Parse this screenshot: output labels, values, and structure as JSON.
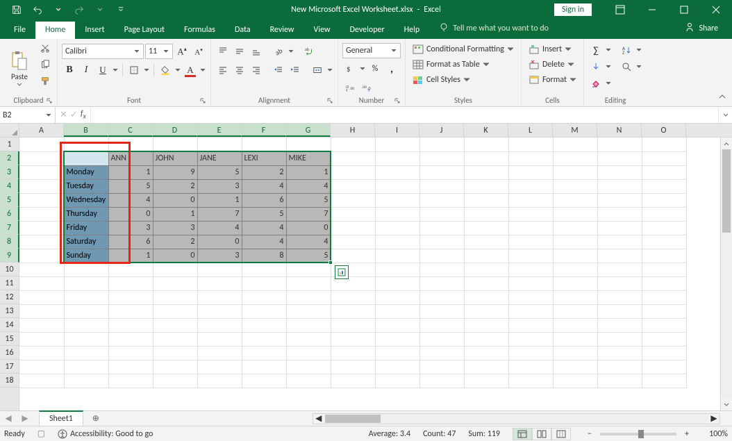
{
  "titlebar": {
    "filename": "New Microsoft Excel Worksheet.xlsx",
    "app": "Excel",
    "signin": "Sign in"
  },
  "tabs": {
    "file": "File",
    "home": "Home",
    "insert": "Insert",
    "pagelayout": "Page Layout",
    "formulas": "Formulas",
    "data": "Data",
    "review": "Review",
    "view": "View",
    "developer": "Developer",
    "help": "Help",
    "tellme": "Tell me what you want to do",
    "share": "Share"
  },
  "ribbon": {
    "clipboard": {
      "label": "Clipboard",
      "paste": "Paste"
    },
    "font": {
      "label": "Font",
      "face": "Calibri",
      "size": "11"
    },
    "alignment": {
      "label": "Alignment"
    },
    "number": {
      "label": "Number",
      "format": "General"
    },
    "styles": {
      "label": "Styles",
      "cond": "Conditional Formatting",
      "table": "Format as Table",
      "cell": "Cell Styles"
    },
    "cells": {
      "label": "Cells",
      "insert": "Insert",
      "delete": "Delete",
      "format": "Format"
    },
    "editing": {
      "label": "Editing"
    }
  },
  "namebox": "B2",
  "formula": "",
  "columns": [
    "A",
    "B",
    "C",
    "D",
    "E",
    "F",
    "G",
    "H",
    "I",
    "J",
    "K",
    "L",
    "M",
    "N",
    "O"
  ],
  "grid": {
    "headers": [
      "",
      "ANN",
      "JOHN",
      "JANE",
      "LEXI",
      "MIKE"
    ],
    "rows": [
      {
        "label": "Monday",
        "v": [
          1,
          9,
          5,
          2,
          1
        ]
      },
      {
        "label": "Tuesday",
        "v": [
          5,
          2,
          3,
          4,
          4
        ]
      },
      {
        "label": "Wednesday",
        "v": [
          4,
          0,
          1,
          6,
          5
        ]
      },
      {
        "label": "Thursday",
        "v": [
          0,
          1,
          7,
          5,
          7
        ]
      },
      {
        "label": "Friday",
        "v": [
          3,
          3,
          4,
          4,
          0
        ]
      },
      {
        "label": "Saturday",
        "v": [
          6,
          2,
          0,
          4,
          4
        ]
      },
      {
        "label": "Sunday",
        "v": [
          1,
          0,
          3,
          8,
          5
        ]
      }
    ]
  },
  "sheettab": "Sheet1",
  "status": {
    "ready": "Ready",
    "accessibility": "Accessibility: Good to go",
    "average": "Average: 3.4",
    "count": "Count: 47",
    "sum": "Sum: 119",
    "zoom": "100%"
  },
  "chart_data": {
    "type": "table",
    "title": "",
    "columns": [
      "",
      "ANN",
      "JOHN",
      "JANE",
      "LEXI",
      "MIKE"
    ],
    "rows": [
      [
        "Monday",
        1,
        9,
        5,
        2,
        1
      ],
      [
        "Tuesday",
        5,
        2,
        3,
        4,
        4
      ],
      [
        "Wednesday",
        4,
        0,
        1,
        6,
        5
      ],
      [
        "Thursday",
        0,
        1,
        7,
        5,
        7
      ],
      [
        "Friday",
        3,
        3,
        4,
        4,
        0
      ],
      [
        "Saturday",
        6,
        2,
        0,
        4,
        4
      ],
      [
        "Sunday",
        1,
        0,
        3,
        8,
        5
      ]
    ]
  }
}
